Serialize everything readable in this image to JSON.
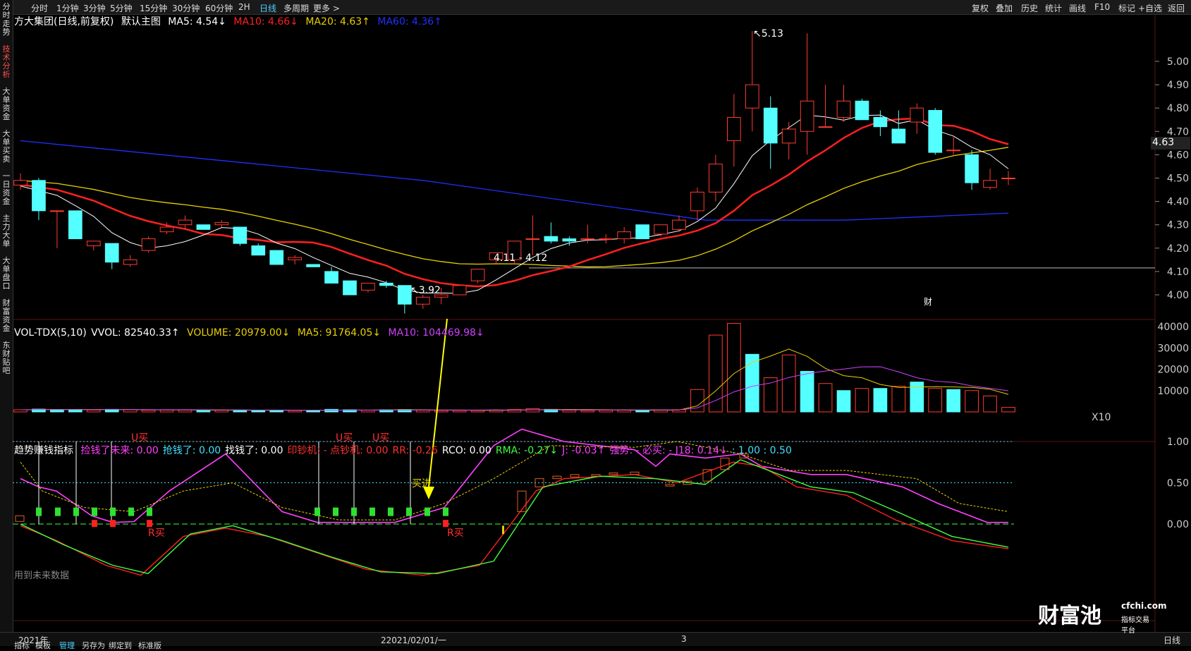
{
  "toolbar": {
    "left": [
      "分时",
      "1分钟",
      "3分钟",
      "5分钟",
      "15分钟",
      "30分钟",
      "60分钟",
      "2H",
      "日线",
      "多周期",
      "更多 >"
    ],
    "right": [
      "复权",
      "叠加",
      "历史",
      "统计",
      "画线",
      "F10",
      "标记",
      "+自选",
      "返回"
    ]
  },
  "sidebar": [
    "分时走势",
    "技术分析",
    "大单资金",
    "大单买卖",
    "一日资金",
    "主力大单",
    "大单盘口",
    "财富资金",
    "东财贴吧"
  ],
  "main": {
    "stock": "方大集团(日线,前复权)",
    "theme": "默认主图",
    "ma5": "MA5: 4.54↓",
    "ma10": "MA10: 4.66↓",
    "ma20": "MA20: 4.63↑",
    "ma60": "MA60: 4.36↑",
    "price_ticks": [
      "5.00",
      "4.90",
      "4.80",
      "4.70",
      "4.60",
      "4.50",
      "4.40",
      "4.30",
      "4.20",
      "4.10",
      "4.00"
    ],
    "current_price": "4.63",
    "high_label": "5.13",
    "low_label": "3.92",
    "range_label": "4.11 - 4.12",
    "marker": "财"
  },
  "volume": {
    "title": "VOL-TDX(5,10)",
    "vvol": "VVOL: 82540.33↑",
    "volume": "VOLUME: 20979.00↓",
    "ma5": "MA5: 91764.05↓",
    "ma10": "MA10: 104469.98↓",
    "ticks": [
      "40000",
      "30000",
      "20000",
      "10000"
    ],
    "unit": "X10"
  },
  "indicator": {
    "title": "趋势赚钱指标",
    "items": [
      {
        "text": "捡钱了未来: 0.00",
        "color": "#ff40ff"
      },
      {
        "text": "抢钱了: 0.00",
        "color": "#40e0ff"
      },
      {
        "text": "找钱了: 0.00",
        "color": "#ffffff"
      },
      {
        "text": "印钞机: - 点钞机: 0.00",
        "color": "#ff3030"
      },
      {
        "text": "RR: -0.26",
        "color": "#ff3030"
      },
      {
        "text": "RCO: 0.00",
        "color": "#ffffff"
      },
      {
        "text": "RMA: -0.27↓",
        "color": "#40ff40"
      },
      {
        "text": "J: -0.03↑",
        "color": "#ff40ff"
      },
      {
        "text": "强势: - 必买: - J18: 0.14↓",
        "color": "#ff40ff"
      },
      {
        "text": ": 1.00 : 0.50",
        "color": "#40e0ff"
      }
    ],
    "ticks": [
      "1.00",
      "0.50",
      "0.00"
    ],
    "labels": {
      "u_buy": "U买",
      "r_buy": "R买",
      "buy_in": "买进"
    },
    "note": "用到未来数据"
  },
  "bottom": {
    "year": "2021年",
    "date": "22021/02/01/一",
    "page": "3",
    "period": "日线",
    "tabs": [
      "指标",
      "模板",
      "管理",
      "另存为",
      "绑定到",
      "标准版"
    ]
  },
  "watermark": {
    "brand": "财富池",
    "site": "cfchi.com",
    "sub": "指标交易平台"
  },
  "colors": {
    "up": "#ff3b30",
    "down": "#54ffff",
    "ma5": "#ffffff",
    "ma10": "#ff2020",
    "ma20": "#e8d000",
    "ma60": "#2030ff",
    "vol_ma5": "#e8d000",
    "vol_ma10": "#d040ff"
  },
  "chart_data": {
    "type": "candlestick",
    "ylim": [
      3.85,
      5.2
    ],
    "candles": [
      [
        4.47,
        4.52,
        4.45,
        4.49
      ],
      [
        4.49,
        4.5,
        4.32,
        4.36
      ],
      [
        4.36,
        4.36,
        4.2,
        4.36
      ],
      [
        4.36,
        4.36,
        4.24,
        4.24
      ],
      [
        4.21,
        4.23,
        4.19,
        4.23
      ],
      [
        4.22,
        4.22,
        4.11,
        4.14
      ],
      [
        4.13,
        4.17,
        4.12,
        4.15
      ],
      [
        4.19,
        4.25,
        4.18,
        4.24
      ],
      [
        4.27,
        4.31,
        4.26,
        4.29
      ],
      [
        4.3,
        4.34,
        4.28,
        4.32
      ],
      [
        4.3,
        4.3,
        4.28,
        4.28
      ],
      [
        4.3,
        4.32,
        4.29,
        4.31
      ],
      [
        4.29,
        4.29,
        4.21,
        4.22
      ],
      [
        4.21,
        4.22,
        4.17,
        4.17
      ],
      [
        4.19,
        4.19,
        4.13,
        4.13
      ],
      [
        4.15,
        4.17,
        4.13,
        4.16
      ],
      [
        4.13,
        4.13,
        4.12,
        4.12
      ],
      [
        4.1,
        4.12,
        4.05,
        4.05
      ],
      [
        4.06,
        4.06,
        4.0,
        4.0
      ],
      [
        4.02,
        4.05,
        4.01,
        4.05
      ],
      [
        4.05,
        4.06,
        4.03,
        4.04
      ],
      [
        4.04,
        4.04,
        3.92,
        3.96
      ],
      [
        3.96,
        4.0,
        3.94,
        3.99
      ],
      [
        3.99,
        4.03,
        3.96,
        4.0
      ],
      [
        4.0,
        4.04,
        4.0,
        4.04
      ],
      [
        4.06,
        4.11,
        4.05,
        4.11
      ],
      [
        4.15,
        4.18,
        4.13,
        4.18
      ],
      [
        4.15,
        4.23,
        4.13,
        4.23
      ],
      [
        4.24,
        4.34,
        4.17,
        4.24
      ],
      [
        4.25,
        4.31,
        4.22,
        4.23
      ],
      [
        4.24,
        4.25,
        4.21,
        4.23
      ],
      [
        4.24,
        4.3,
        4.22,
        4.24
      ],
      [
        4.24,
        4.26,
        4.22,
        4.24
      ],
      [
        4.24,
        4.29,
        4.22,
        4.27
      ],
      [
        4.3,
        4.3,
        4.24,
        4.24
      ],
      [
        4.26,
        4.3,
        4.25,
        4.3
      ],
      [
        4.28,
        4.34,
        4.27,
        4.32
      ],
      [
        4.36,
        4.46,
        4.32,
        4.44
      ],
      [
        4.44,
        4.6,
        4.4,
        4.56
      ],
      [
        4.66,
        4.86,
        4.55,
        4.76
      ],
      [
        4.8,
        5.13,
        4.7,
        4.9
      ],
      [
        4.8,
        4.85,
        4.54,
        4.65
      ],
      [
        4.65,
        4.74,
        4.58,
        4.71
      ],
      [
        4.7,
        5.12,
        4.6,
        4.83
      ],
      [
        4.72,
        4.9,
        4.72,
        4.72
      ],
      [
        4.76,
        4.9,
        4.74,
        4.83
      ],
      [
        4.83,
        4.84,
        4.77,
        4.75
      ],
      [
        4.76,
        4.79,
        4.68,
        4.72
      ],
      [
        4.71,
        4.79,
        4.67,
        4.65
      ],
      [
        4.74,
        4.82,
        4.69,
        4.8
      ],
      [
        4.79,
        4.8,
        4.6,
        4.61
      ],
      [
        4.62,
        4.68,
        4.6,
        4.62
      ],
      [
        4.6,
        4.62,
        4.45,
        4.48
      ],
      [
        4.46,
        4.54,
        4.45,
        4.49
      ],
      [
        4.5,
        4.53,
        4.47,
        4.5
      ]
    ],
    "volumes": [
      [
        1000,
        1
      ],
      [
        1300,
        0
      ],
      [
        1100,
        0
      ],
      [
        1100,
        0
      ],
      [
        900,
        1
      ],
      [
        1200,
        0
      ],
      [
        1000,
        1
      ],
      [
        800,
        1
      ],
      [
        900,
        1
      ],
      [
        900,
        1
      ],
      [
        700,
        0
      ],
      [
        800,
        1
      ],
      [
        900,
        0
      ],
      [
        700,
        0
      ],
      [
        800,
        0
      ],
      [
        700,
        1
      ],
      [
        600,
        0
      ],
      [
        1200,
        0
      ],
      [
        1000,
        0
      ],
      [
        800,
        1
      ],
      [
        1000,
        0
      ],
      [
        1100,
        0
      ],
      [
        800,
        1
      ],
      [
        700,
        1
      ],
      [
        700,
        1
      ],
      [
        700,
        1
      ],
      [
        900,
        1
      ],
      [
        1100,
        1
      ],
      [
        1500,
        1
      ],
      [
        1200,
        0
      ],
      [
        800,
        1
      ],
      [
        700,
        1
      ],
      [
        800,
        1
      ],
      [
        900,
        1
      ],
      [
        800,
        0
      ],
      [
        900,
        1
      ],
      [
        1000,
        1
      ],
      [
        10500,
        1
      ],
      [
        36000,
        1
      ],
      [
        41500,
        1
      ],
      [
        27000,
        0
      ],
      [
        16000,
        1
      ],
      [
        26700,
        1
      ],
      [
        19000,
        0
      ],
      [
        13300,
        1
      ],
      [
        10000,
        0
      ],
      [
        11000,
        1
      ],
      [
        11000,
        0
      ],
      [
        12000,
        1
      ],
      [
        14000,
        0
      ],
      [
        11000,
        1
      ],
      [
        10500,
        0
      ],
      [
        10000,
        1
      ],
      [
        7500,
        1
      ],
      [
        2100,
        1
      ]
    ]
  }
}
